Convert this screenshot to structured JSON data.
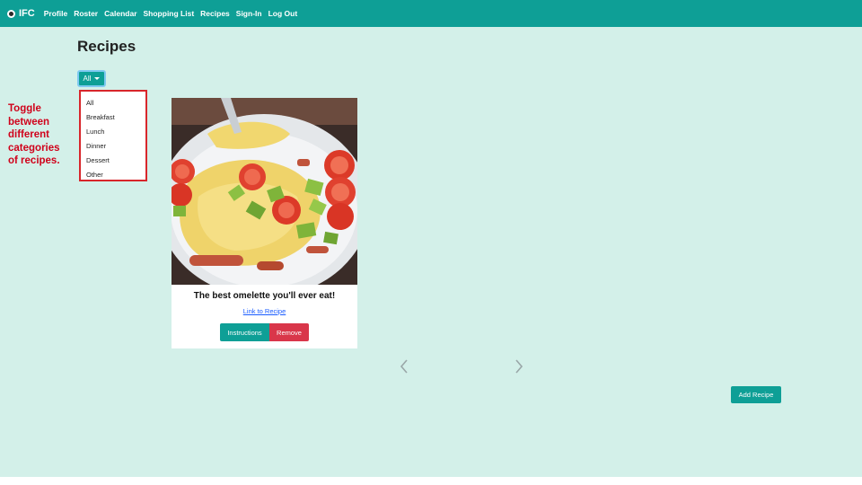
{
  "navbar": {
    "brand": "IFC",
    "links": [
      "Profile",
      "Roster",
      "Calendar",
      "Shopping List",
      "Recipes",
      "Sign-In",
      "Log Out"
    ]
  },
  "page_title": "Recipes",
  "category_filter": {
    "selected": "All",
    "options": [
      "All",
      "Breakfast",
      "Lunch",
      "Dinner",
      "Dessert",
      "Other"
    ]
  },
  "annotation": {
    "lines": [
      "Toggle",
      "between",
      "different",
      "categories",
      "of recipes."
    ]
  },
  "recipe_card": {
    "title": "The best omelette you'll ever eat!",
    "link_text": "Link to Recipe",
    "instructions_label": "Instructions",
    "remove_label": "Remove"
  },
  "add_recipe_label": "Add Recipe",
  "colors": {
    "navbar": "#0e9f96",
    "page_background": "#d3f0e9",
    "primary_button": "#0e9f96",
    "danger_button": "#d9364a",
    "annotation": "#d0021b"
  },
  "icons": {
    "brand": "logo-icon",
    "dropdown": "caret-down-icon",
    "prev": "chevron-left-icon",
    "next": "chevron-right-icon"
  }
}
